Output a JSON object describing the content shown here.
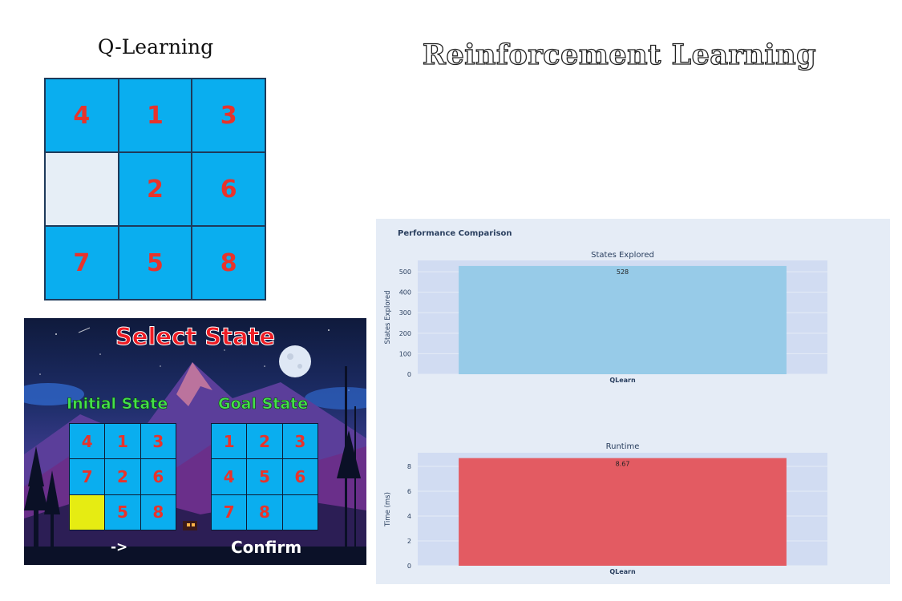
{
  "header": {
    "algo_title": "Q-Learning",
    "main_title": "Reinforcement Learning"
  },
  "board": {
    "tiles": [
      "4",
      "1",
      "3",
      "",
      "2",
      "6",
      "7",
      "5",
      "8"
    ]
  },
  "select_panel": {
    "title": "Select State",
    "initial_label": "Initial State",
    "goal_label": "Goal State",
    "initial_tiles": [
      "4",
      "1",
      "3",
      "7",
      "2",
      "6",
      "",
      "5",
      "8"
    ],
    "goal_tiles": [
      "1",
      "2",
      "3",
      "4",
      "5",
      "6",
      "7",
      "8",
      ""
    ],
    "arrow_label": "->",
    "confirm_label": "Confirm"
  },
  "colors": {
    "tile": "#0aaeef",
    "tile_number": "#e8332b",
    "selected_tile": "#e6ec12",
    "states_bar": "#97cbe8",
    "runtime_bar": "#e35b62"
  },
  "chart_data": {
    "type": "bar",
    "title": "Performance Comparison",
    "subplots": [
      {
        "title": "States Explored",
        "categories": [
          "QLearn"
        ],
        "values": [
          528
        ],
        "data_labels": [
          "528"
        ],
        "ylabel": "States Explored",
        "yticks": [
          "0",
          "100",
          "200",
          "300",
          "400",
          "500"
        ],
        "ylim": [
          0,
          555
        ]
      },
      {
        "title": "Runtime",
        "categories": [
          "QLearn"
        ],
        "values": [
          8.67
        ],
        "data_labels": [
          "8.67"
        ],
        "ylabel": "Time (ms)",
        "yticks": [
          "0",
          "2",
          "4",
          "6",
          "8"
        ],
        "ylim": [
          0,
          9.1
        ]
      }
    ]
  }
}
